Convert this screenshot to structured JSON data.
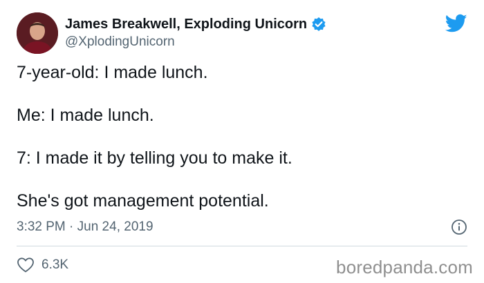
{
  "author": {
    "display_name": "James Breakwell, Exploding Unicorn",
    "handle": "@XplodingUnicorn",
    "verified": true,
    "avatar_icon": "profile-photo"
  },
  "tweet": {
    "lines": [
      "7-year-old: I made lunch.",
      "Me: I made lunch.",
      "7: I made it by telling you to make it.",
      "She's got management potential."
    ],
    "timestamp": "3:32 PM · Jun 24, 2019",
    "likes": "6.3K"
  },
  "watermark": "boredpanda.com",
  "icons": {
    "brand": "twitter-bird-icon",
    "verified": "verified-badge-icon",
    "info": "info-icon",
    "like": "heart-icon"
  },
  "colors": {
    "twitter_blue": "#1d9bf0",
    "text": "#0f1419",
    "secondary_text": "#536471",
    "divider": "#cfd9de",
    "watermark": "#8f8f8f"
  }
}
